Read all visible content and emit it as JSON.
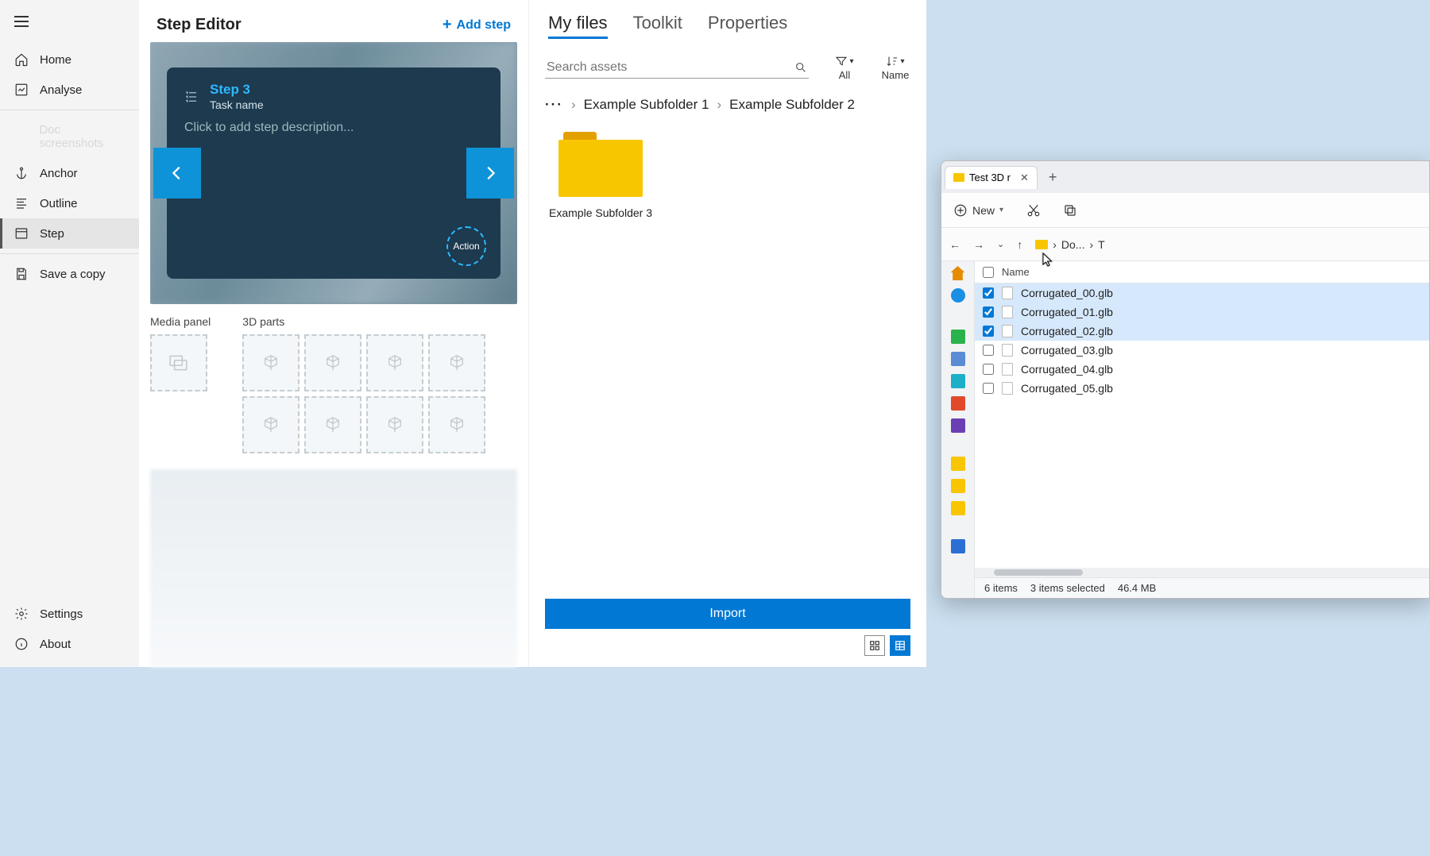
{
  "sidebar": {
    "items": [
      {
        "label": "Home"
      },
      {
        "label": "Analyse"
      },
      {
        "label": "Doc screenshots"
      },
      {
        "label": "Anchor"
      },
      {
        "label": "Outline"
      },
      {
        "label": "Step"
      },
      {
        "label": "Save a copy"
      }
    ],
    "footer": [
      {
        "label": "Settings"
      },
      {
        "label": "About"
      }
    ]
  },
  "center": {
    "title": "Step Editor",
    "add_label": "Add step",
    "step": {
      "title": "Step 3",
      "task": "Task name",
      "desc_placeholder": "Click to add step description...",
      "action_label": "Action"
    },
    "media_label": "Media panel",
    "parts_label": "3D parts"
  },
  "right": {
    "tabs": [
      "My files",
      "Toolkit",
      "Properties"
    ],
    "search_placeholder": "Search assets",
    "filter_label": "All",
    "sort_label": "Name",
    "breadcrumb": [
      "Example Subfolder 1",
      "Example Subfolder 2"
    ],
    "folder": "Example Subfolder 3",
    "import_label": "Import"
  },
  "explorer": {
    "tab_title": "Test 3D r",
    "new_label": "New",
    "path_seg": "Do...",
    "name_header": "Name",
    "files": [
      {
        "name": "Corrugated_00.glb",
        "selected": true
      },
      {
        "name": "Corrugated_01.glb",
        "selected": true
      },
      {
        "name": "Corrugated_02.glb",
        "selected": true
      },
      {
        "name": "Corrugated_03.glb",
        "selected": false
      },
      {
        "name": "Corrugated_04.glb",
        "selected": false
      },
      {
        "name": "Corrugated_05.glb",
        "selected": false
      }
    ],
    "status_count": "6 items",
    "status_sel": "3 items selected",
    "status_size": "46.4 MB"
  }
}
